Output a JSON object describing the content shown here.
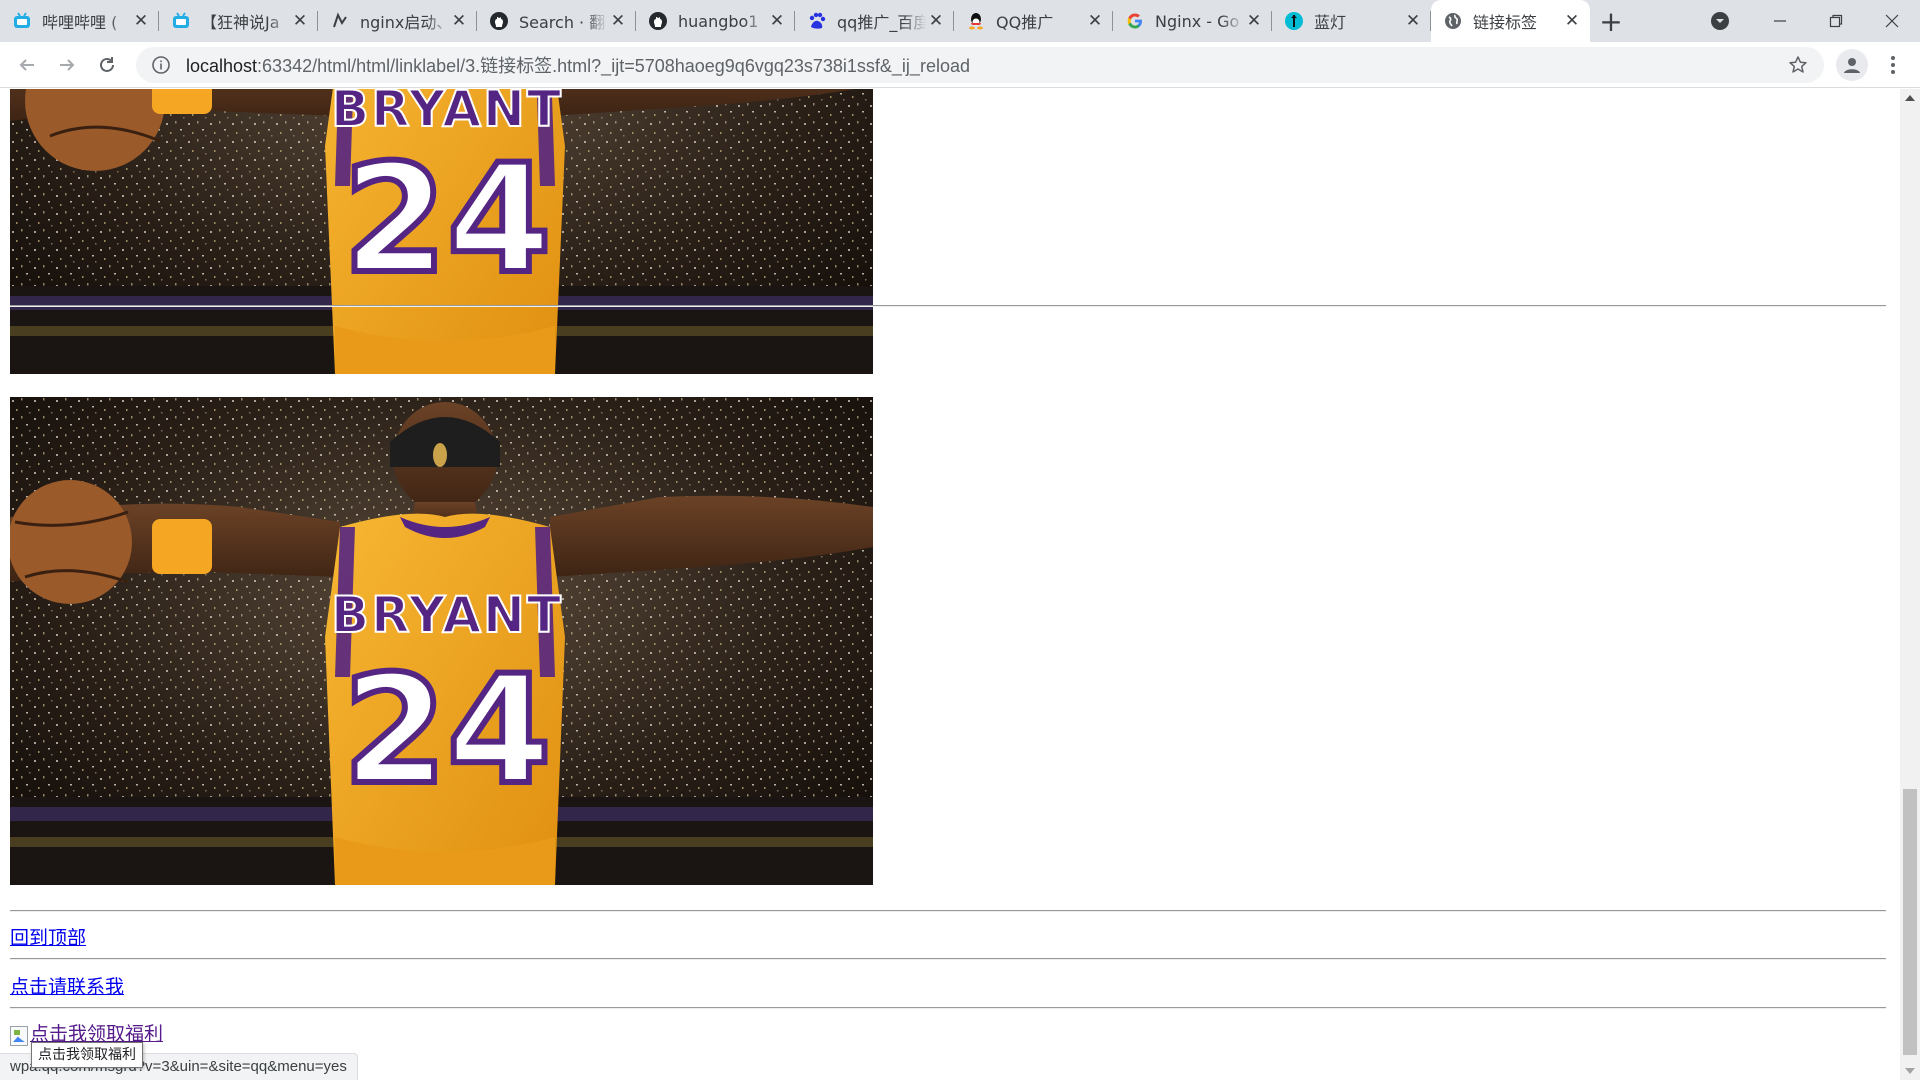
{
  "browser": {
    "tabs": [
      {
        "title": "哔哩哔哩 (",
        "icon": "bilibili-icon"
      },
      {
        "title": "【狂神说Ja",
        "icon": "bilibili-icon"
      },
      {
        "title": "nginx启动、",
        "icon": "nginx-icon"
      },
      {
        "title": "Search · 翻",
        "icon": "github-icon"
      },
      {
        "title": "huangbo1",
        "icon": "github-icon"
      },
      {
        "title": "qq推广_百度",
        "icon": "baidu-icon"
      },
      {
        "title": "QQ推广",
        "icon": "qq-icon"
      },
      {
        "title": "Nginx - Go",
        "icon": "google-icon"
      },
      {
        "title": "蓝灯",
        "icon": "lantern-icon"
      },
      {
        "title": "链接标签",
        "icon": "globe-icon",
        "active": true
      }
    ],
    "address_bar": {
      "host": "localhost",
      "rest": ":63342/html/html/linklabel/3.链接标签.html?_ijt=5708haoeg9q6vgq23s738i1ssf&_ij_reload"
    }
  },
  "page": {
    "photo_jersey_name": "BRYANT",
    "photo_jersey_number": "24",
    "photo_alt_1": "Kobe Bryant #24 back view (cropped top)",
    "photo_alt_2": "Kobe Bryant #24 back view",
    "back_to_top_link": "回到顶部",
    "contact_link": "点击请联系我",
    "welfare_link": "点击我领取福利"
  },
  "status": {
    "hover_url": "wpa.qq.com/msgrd?v=3&uin=&site=qq&menu=yes",
    "tooltip": "点击我领取福利"
  },
  "colors": {
    "tabstrip": "#dee1e6",
    "link": "#0000ee",
    "visited_link": "#551a8b",
    "jersey_gold": "#f5a623",
    "jersey_purple": "#552583"
  }
}
